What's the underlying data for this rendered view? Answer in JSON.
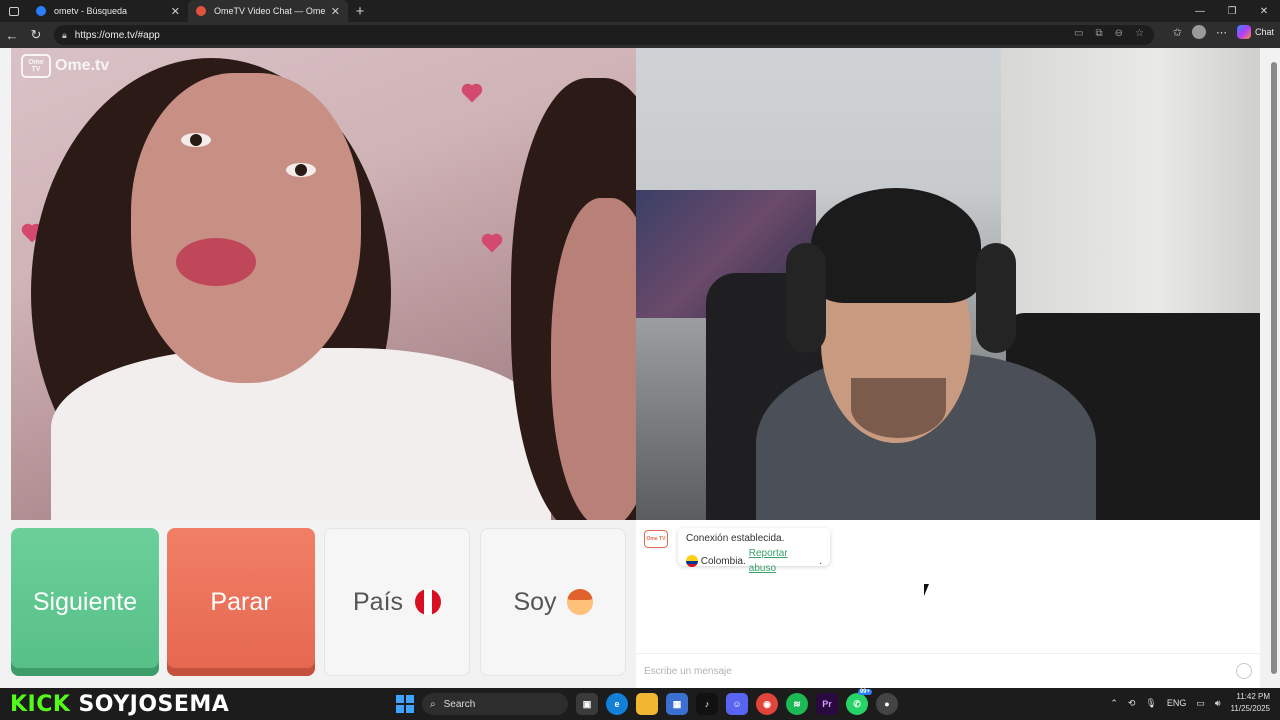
{
  "browser": {
    "tabs": [
      {
        "title": "ometv - Búsqueda",
        "active": false,
        "icon_color": "#2a7fff"
      },
      {
        "title": "OmeTV Video Chat — Omeg",
        "active": true,
        "icon_color": "#e0533d"
      }
    ],
    "close_glyph": "✕",
    "new_tab_glyph": "+",
    "window_controls": {
      "minimize": "—",
      "restore": "❐",
      "close": "✕"
    },
    "nav": {
      "back": "←",
      "reload": "↻"
    },
    "url": "https://ome.tv/#app",
    "chat_button_label": "Chat"
  },
  "app": {
    "logo": {
      "box_text": "Ome TV",
      "brand": "Ome.tv"
    },
    "controls": {
      "next_label": "Siguiente",
      "stop_label": "Parar",
      "country_label": "País",
      "gender_label": "Soy"
    },
    "chat": {
      "icon_text": "Ome TV",
      "system_message": "Conexión establecida.",
      "country": "Colombia.",
      "report_link": "Reportar abuso",
      "report_suffix": ".",
      "input_placeholder": "Escribe un mensaje"
    }
  },
  "overlay": {
    "kick_word": "KICK",
    "username": "SOYJOSEMA"
  },
  "taskbar": {
    "search_label": "Search",
    "apps": [
      "task-view",
      "edge",
      "file-explorer",
      "store",
      "tiktok",
      "discord",
      "chrome",
      "spotify",
      "premiere",
      "whatsapp",
      "recorder"
    ],
    "whatsapp_badge": "99+",
    "tray": {
      "language": "ENG",
      "time": "11:42 PM",
      "date": "11/25/2025"
    }
  },
  "colors": {
    "next": "#5ec98f",
    "stop": "#ea6f56",
    "kick_green": "#53fc18",
    "link_green": "#3aa26a"
  }
}
